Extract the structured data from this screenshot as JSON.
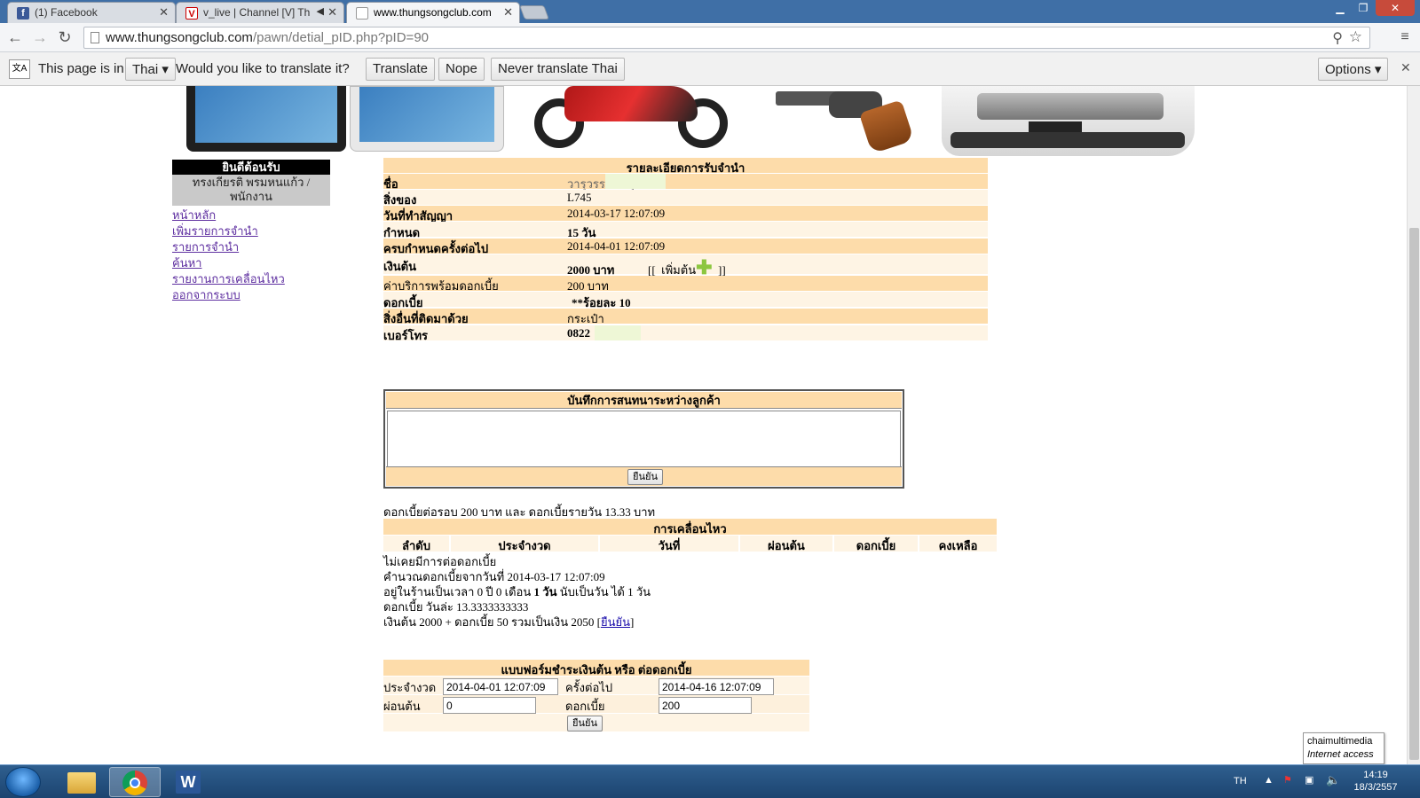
{
  "browser": {
    "tabs": [
      {
        "title": "(1) Facebook",
        "icon": "facebook-icon"
      },
      {
        "title": "v_live | Channel [V] Th",
        "icon": "channel-v-icon"
      },
      {
        "title": "www.thungsongclub.com",
        "icon": "page-icon"
      }
    ],
    "url_host": "www.thungsongclub.com",
    "url_path": "/pawn/detial_pID.php?pID=90"
  },
  "translate_bar": {
    "page_is_in": "This page is in",
    "language": "Thai",
    "question": "Would you like to translate it?",
    "translate": "Translate",
    "nope": "Nope",
    "never": "Never translate Thai",
    "options": "Options"
  },
  "sidebar": {
    "welcome": "ยินดีต้อนรับ",
    "user_line1": "ทรงเกียรติ พรมหนแก้ว /",
    "user_line2": "พนักงาน",
    "links": [
      "หน้าหลัก",
      "เพิ่มรายการจำนำ",
      "รายการจำนำ",
      "ค้นหา",
      "รายงานการเคลื่อนไหว",
      "ออกจากระบบ"
    ]
  },
  "detail": {
    "title": "รายละเอียดการรับจำนำ",
    "rows": [
      {
        "label": "ชื่อ",
        "value": "วารุวรรณ ขนุน"
      },
      {
        "label": "สิ่งของ",
        "value": "L745"
      },
      {
        "label": "วันที่ทำสัญญา",
        "value": "2014-03-17 12:07:09"
      },
      {
        "label": "กำหนด",
        "value": "15 วัน"
      },
      {
        "label": "ครบกำหนดครั้งต่อไป",
        "value": "2014-04-01 12:07:09"
      },
      {
        "label": "เงินต้น",
        "value": "2000 บาท"
      },
      {
        "label": "ค่าบริการพร้อมดอกเบี้ย",
        "value": "200 บาท"
      },
      {
        "label": "ดอกเบี้ย",
        "value": "**ร้อยละ 10"
      },
      {
        "label": "สิ่งอื่นที่ติดมาด้วย",
        "value": "กระเป๋า"
      },
      {
        "label": "เบอร์โทร",
        "value": "0822"
      }
    ],
    "add_principal_open": "[[",
    "add_principal": "เพิ่มต้น",
    "add_principal_close": "]]"
  },
  "note": {
    "title": "บันทึกการสนทนาระหว่างลูกค้า",
    "submit": "ยืนยัน"
  },
  "interest_summary": "ดอกเบี้ยต่อรอบ 200 บาท และ ดอกเบี้ยรายวัน 13.33 บาท",
  "movement": {
    "title": "การเคลื่อนไหว",
    "columns": [
      "ลำดับ",
      "ประจำงวด",
      "วันที่",
      "ผ่อนต้น",
      "ดอกเบี้ย",
      "คงเหลือ"
    ],
    "lines": [
      "ไม่เคยมีการต่อดอกเบี้ย",
      "คำนวณดอกเบี้ยจากวันที่ 2014-03-17 12:07:09",
      "อยู่ในร้านเป็นเวลา 0 ปี 0 เดือน",
      "1 วัน",
      "นับเป็นวัน ได้ 1 วัน",
      "ดอกเบี้ย วันล่ะ 13.3333333333",
      "เงินต้น 2000 + ดอกเบี้ย 50 รวมเป็นเงิน 2050 [",
      "ยืนยัน",
      "]"
    ]
  },
  "payment_form": {
    "title": "แบบฟอร์มชำระเงินต้น หรือ ต่อดอกเบี้ย",
    "period_label": "ประจำงวด",
    "period_value": "2014-04-01 12:07:09",
    "next_label": "ครั้งต่อไป",
    "next_value": "2014-04-16 12:07:09",
    "principal_label": "ผ่อนต้น",
    "principal_value": "0",
    "interest_label": "ดอกเบี้ย",
    "interest_value": "200",
    "submit": "ยืนยัน"
  },
  "tooltip": {
    "line1": "chaimultimedia",
    "line2": "Internet access"
  },
  "taskbar": {
    "lang": "TH",
    "time": "14:19",
    "date": "18/3/2557"
  }
}
